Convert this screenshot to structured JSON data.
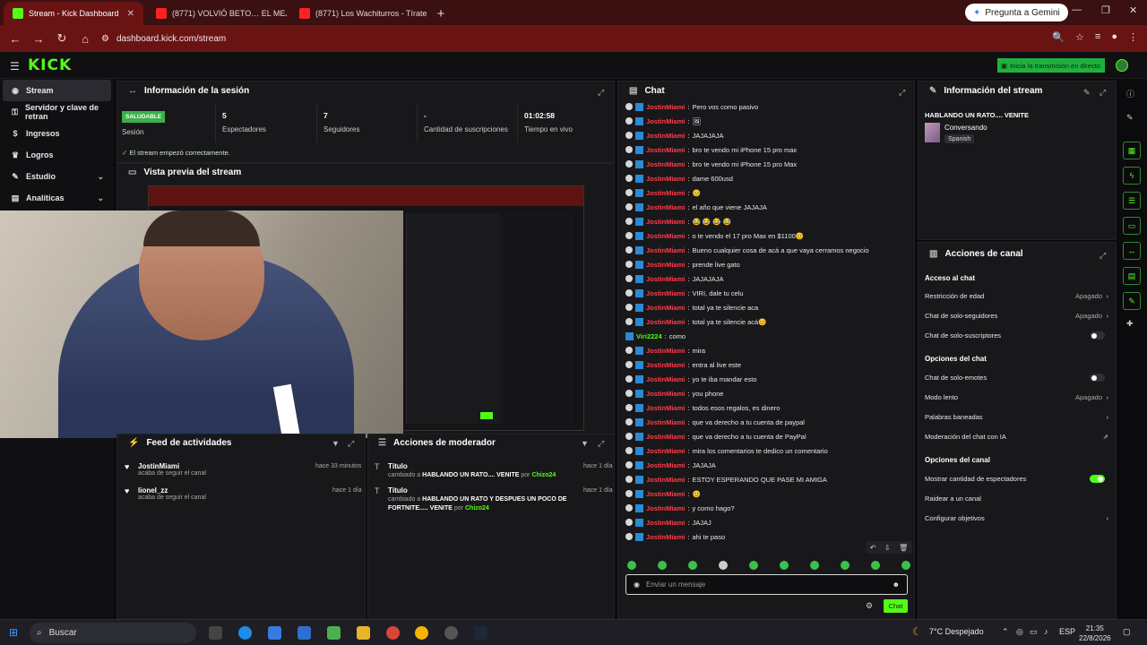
{
  "browser": {
    "tabs": [
      {
        "title": "Stream - Kick Dashboard",
        "fav": "#53fc18"
      },
      {
        "title": "(8771) VOLVIÓ BETO… EL MEJO",
        "fav": "#ff2222"
      },
      {
        "title": "(8771) Los Wachiturros - Tírate",
        "fav": "#ff2222"
      }
    ],
    "gemini_label": "Pregunta a Gemini",
    "url": "dashboard.kick.com/stream"
  },
  "header": {
    "logo": "KICK",
    "go_live": "Inicia la transmisión en directo"
  },
  "sidebar": {
    "items": [
      {
        "label": "Stream",
        "icon": "broadcast-icon"
      },
      {
        "label": "Servidor y clave de retran",
        "icon": "key-icon"
      },
      {
        "label": "Ingresos",
        "icon": "dollar-icon"
      },
      {
        "label": "Logros",
        "icon": "trophy-icon"
      },
      {
        "label": "Estudio",
        "icon": "studio-icon"
      },
      {
        "label": "Analíticas",
        "icon": "chart-icon"
      }
    ]
  },
  "session": {
    "title": "Información de la sesión",
    "badge": "SALUDABLE",
    "stats": [
      {
        "value": "",
        "label": "Sesión"
      },
      {
        "value": "5",
        "label": "Espectadores"
      },
      {
        "value": "7",
        "label": "Seguidores"
      },
      {
        "value": "-",
        "label": "Cantidad de suscripciones"
      },
      {
        "value": "01:02:58",
        "label": "Tiempo en vivo"
      }
    ],
    "status": "El stream empezó correctamente."
  },
  "preview": {
    "title": "Vista previa del stream"
  },
  "feed": {
    "title": "Feed de actividades",
    "items": [
      {
        "name": "JostinMiami",
        "desc": "acaba de seguir el canal",
        "time": "hace 33 minutos"
      },
      {
        "name": "lionel_zz",
        "desc": "acaba de seguir el canal",
        "time": "hace 1 día"
      }
    ]
  },
  "modactions": {
    "title": "Acciones de moderador",
    "items": [
      {
        "head": "Título",
        "pre": "cambiado a",
        "text": "HABLANDO UN RATO.... VENITE",
        "by": "por",
        "user": "Chizo24",
        "time": "hace 1 día"
      },
      {
        "head": "Título",
        "pre": "cambiado a",
        "text": "HABLANDO UN RATO Y DESPUES UN POCO DE FORTNITE..... VENITE",
        "by": "por",
        "user": "Chizo24",
        "time": "hace 1 día"
      }
    ]
  },
  "chat": {
    "title": "Chat",
    "messages": [
      {
        "user": "JostinMiami",
        "text": "Pero vos como pasivo"
      },
      {
        "user": "JostinMiami",
        "text": "🖼"
      },
      {
        "user": "JostinMiami",
        "text": "JAJAJAJA"
      },
      {
        "user": "JostinMiami",
        "text": "bro te vendo mi iPhone 15 pro max"
      },
      {
        "user": "JostinMiami",
        "text": "bro te vendo mi iPhone 15 pro Max"
      },
      {
        "user": "JostinMiami",
        "text": "dame 600usd"
      },
      {
        "user": "JostinMiami",
        "text": "😊"
      },
      {
        "user": "JostinMiami",
        "text": "el año que viene JAJAJA"
      },
      {
        "user": "JostinMiami",
        "text": "😂 😂 😂 😂"
      },
      {
        "user": "JostinMiami",
        "text": "o te vendo el 17 pro Max en $1100😊"
      },
      {
        "user": "JostinMiami",
        "text": "Bueno cualquier cosa de acá a que vaya cerramos negocio"
      },
      {
        "user": "JostinMiami",
        "text": "prende live gato"
      },
      {
        "user": "JostinMiami",
        "text": "JAJAJAJA"
      },
      {
        "user": "JostinMiami",
        "text": "VIRI, dale tu celu"
      },
      {
        "user": "JostinMiami",
        "text": "total ya te silencie aca"
      },
      {
        "user": "JostinMiami",
        "text": "total ya te silencie acá😊"
      },
      {
        "user": "Viri2224",
        "text": "como",
        "green": true
      },
      {
        "user": "JostinMiami",
        "text": "mira"
      },
      {
        "user": "JostinMiami",
        "text": "entra al live este"
      },
      {
        "user": "JostinMiami",
        "text": "yo te iba mandar esto"
      },
      {
        "user": "JostinMiami",
        "text": "you phone"
      },
      {
        "user": "JostinMiami",
        "text": "todos esos regalos, es dinero"
      },
      {
        "user": "JostinMiami",
        "text": "que va derecho a tu cuenta de paypal"
      },
      {
        "user": "JostinMiami",
        "text": "que va derecho a tu cuenta de PayPal"
      },
      {
        "user": "JostinMiami",
        "text": "mira los comentarios te dedico un comentario"
      },
      {
        "user": "JostinMiami",
        "text": "JAJAJA"
      },
      {
        "user": "JostinMiami",
        "text": "ESTOY ESPERANDO QUE PASE MI AMIGA"
      },
      {
        "user": "JostinMiami",
        "text": "😊"
      },
      {
        "user": "JostinMiami",
        "text": "y como hago?"
      },
      {
        "user": "JostinMiami",
        "text": "JAJAJ"
      },
      {
        "user": "JostinMiami",
        "text": "ahi te paso"
      }
    ],
    "input_placeholder": "Enviar un mensaje",
    "send_label": "Chat"
  },
  "stream_info": {
    "title": "Información del stream",
    "stream_title": "HABLANDO UN RATO.... VENITE",
    "category": "Conversando",
    "language": "Spanish"
  },
  "channel_actions": {
    "title": "Acciones de canal",
    "chat_access": "Acceso al chat",
    "rows1": [
      {
        "label": "Restricción de edad",
        "value": "Apagado",
        "arrow": true
      },
      {
        "label": "Chat de solo-seguidores",
        "value": "Apagado",
        "arrow": true
      },
      {
        "label": "Chat de solo-suscriptores",
        "toggle": "off"
      }
    ],
    "chat_options": "Opciones del chat",
    "rows2": [
      {
        "label": "Chat de solo-emotes",
        "toggle": "off"
      },
      {
        "label": "Modo lento",
        "value": "Apagado",
        "arrow": true
      },
      {
        "label": "Palabras baneadas",
        "arrow": true
      },
      {
        "label": "Moderación del chat con IA",
        "ext": true
      }
    ],
    "channel_options": "Opciones del canal",
    "rows3": [
      {
        "label": "Mostrar cantidad de espectadores",
        "toggle": "on"
      },
      {
        "label": "Raidear a un canal"
      },
      {
        "label": "Configurar objetivos",
        "arrow": true
      }
    ]
  },
  "taskbar": {
    "search": "Buscar",
    "weather": "7°C Despejado",
    "lang": "ESP",
    "time": "21:35",
    "date": "22/8/2026"
  }
}
